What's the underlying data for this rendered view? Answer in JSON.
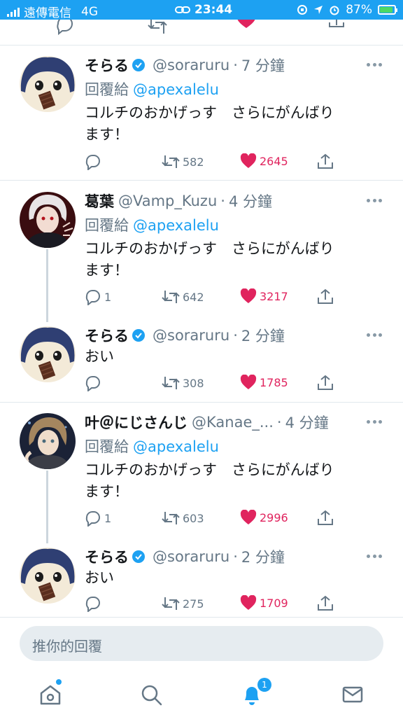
{
  "status_bar": {
    "carrier": "遠傳電信",
    "network": "4G",
    "time": "23:44",
    "battery": "87%"
  },
  "tweets": [
    {
      "name": "そらる",
      "verified": true,
      "handle": "@soraruru",
      "time": "7 分鐘",
      "reply_prefix": "回覆給",
      "reply_to": "@apexalelu",
      "text_line1": "コルチのおかげっす　さらにがんばり",
      "text_line2": "ます！",
      "reply_count": "",
      "retweet_count": "582",
      "like_count": "2645",
      "avatar": "soraru-avatar"
    },
    {
      "name": "葛葉",
      "verified": false,
      "handle": "@Vamp_Kuzu",
      "time": "4 分鐘",
      "reply_prefix": "回覆給",
      "reply_to": "@apexalelu",
      "text_line1": "コルチのおかげっす　さらにがんばり",
      "text_line2": "ます！",
      "reply_count": "1",
      "retweet_count": "642",
      "like_count": "3217",
      "avatar": "kuzuha-avatar"
    },
    {
      "name": "そらる",
      "verified": true,
      "handle": "@soraruru",
      "time": "2 分鐘",
      "text_line1": "おい",
      "reply_count": "",
      "retweet_count": "308",
      "like_count": "1785",
      "avatar": "soraru-avatar"
    },
    {
      "name": "叶＠にじさんじ",
      "verified": false,
      "handle": "@Kanae_...",
      "time": "4 分鐘",
      "reply_prefix": "回覆給",
      "reply_to": "@apexalelu",
      "text_line1": "コルチのおかげっす　さらにがんばり",
      "text_line2": "ます！",
      "reply_count": "1",
      "retweet_count": "603",
      "like_count": "2996",
      "avatar": "kanae-avatar"
    },
    {
      "name": "そらる",
      "verified": true,
      "handle": "@soraruru",
      "time": "2 分鐘",
      "text_line1": "おい",
      "reply_count": "",
      "retweet_count": "275",
      "like_count": "1709",
      "avatar": "soraru-avatar"
    }
  ],
  "reply_bar": {
    "placeholder": "推你的回覆"
  },
  "tab_bar": {
    "items": [
      "home-icon",
      "search-icon",
      "notifications-icon",
      "messages-icon"
    ],
    "notifications_badge": "1"
  },
  "colors": {
    "accent": "#1da1f2",
    "like": "#e0245e",
    "muted": "#657786"
  }
}
